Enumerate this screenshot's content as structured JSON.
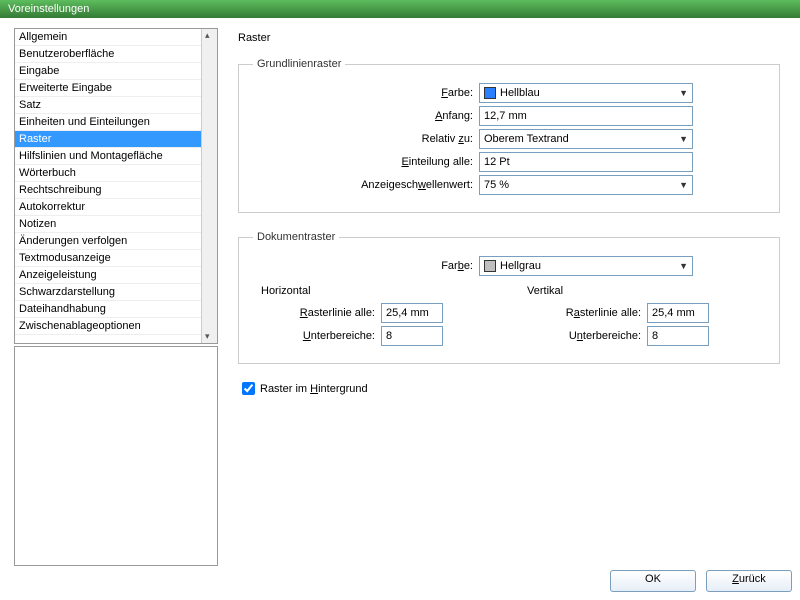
{
  "window": {
    "title": "Voreinstellungen"
  },
  "sidebar": {
    "items": [
      {
        "label": "Allgemein"
      },
      {
        "label": "Benutzeroberfläche"
      },
      {
        "label": "Eingabe"
      },
      {
        "label": "Erweiterte Eingabe"
      },
      {
        "label": "Satz"
      },
      {
        "label": "Einheiten und Einteilungen"
      },
      {
        "label": "Raster",
        "selected": true
      },
      {
        "label": "Hilfslinien und Montagefläche"
      },
      {
        "label": "Wörterbuch"
      },
      {
        "label": "Rechtschreibung"
      },
      {
        "label": "Autokorrektur"
      },
      {
        "label": "Notizen"
      },
      {
        "label": "Änderungen verfolgen"
      },
      {
        "label": "Textmodusanzeige"
      },
      {
        "label": "Anzeigeleistung"
      },
      {
        "label": "Schwarzdarstellung"
      },
      {
        "label": "Dateihandhabung"
      },
      {
        "label": "Zwischenablageoptionen"
      }
    ]
  },
  "page": {
    "title": "Raster",
    "baseline": {
      "legend": "Grundlinienraster",
      "color_label": "Farbe:",
      "color_value": "Hellblau",
      "color_hex": "#2a7fff",
      "start_label": "Anfang:",
      "start_value": "12,7 mm",
      "relative_label": "Relativ zu:",
      "relative_value": "Oberem Textrand",
      "increment_label": "Einteilung alle:",
      "increment_value": "12 Pt",
      "threshold_label": "Anzeigeschwellenwert:",
      "threshold_value": "75 %"
    },
    "document": {
      "legend": "Dokumentraster",
      "color_label": "Farbe:",
      "color_value": "Hellgrau",
      "color_hex": "#bfbfbf",
      "horizontal": {
        "title": "Horizontal",
        "gridline_label": "Rasterlinie alle:",
        "gridline_value": "25,4 mm",
        "subdiv_label": "Unterbereiche:",
        "subdiv_value": "8"
      },
      "vertical": {
        "title": "Vertikal",
        "gridline_label": "Rasterlinie alle:",
        "gridline_value": "25,4 mm",
        "subdiv_label": "Unterbereiche:",
        "subdiv_value": "8"
      }
    },
    "grids_in_back": {
      "label": "Raster im Hintergrund",
      "checked": true
    }
  },
  "footer": {
    "ok": "OK",
    "back": "Zurück"
  }
}
